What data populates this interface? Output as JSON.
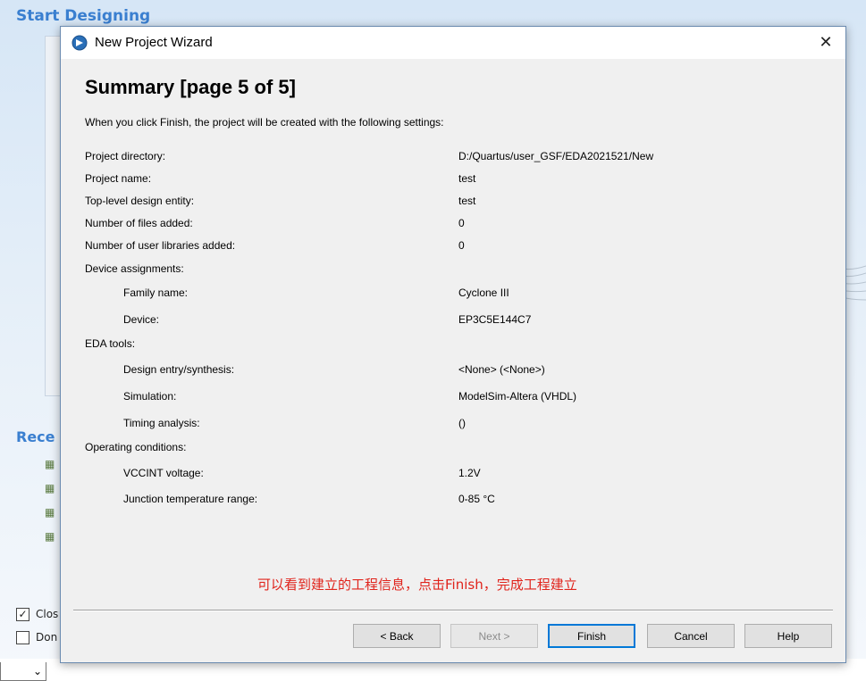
{
  "background": {
    "section_title": "Start Designing",
    "recent_title": "Rece",
    "checkbox1_label": "Clos",
    "checkbox2_label": "Don",
    "checkbox1_checked": true
  },
  "dialog": {
    "title": "New Project Wizard",
    "heading": "Summary [page 5 of 5]",
    "intro": "When you click Finish, the project will be created with the following settings:",
    "rows": [
      {
        "label": "Project directory:",
        "value": "D:/Quartus/user_GSF/EDA2021521/New"
      },
      {
        "label": "Project name:",
        "value": "test"
      },
      {
        "label": "Top-level design entity:",
        "value": "test"
      },
      {
        "label": "Number of files added:",
        "value": "0"
      },
      {
        "label": "Number of user libraries added:",
        "value": "0"
      },
      {
        "label": "Device assignments:",
        "value": ""
      },
      {
        "label": "Family name:",
        "value": "Cyclone III"
      },
      {
        "label": "Device:",
        "value": "EP3C5E144C7"
      },
      {
        "label": "EDA tools:",
        "value": ""
      },
      {
        "label": "Design entry/synthesis:",
        "value": "<None> (<None>)"
      },
      {
        "label": "Simulation:",
        "value": "ModelSim-Altera (VHDL)"
      },
      {
        "label": "Timing analysis:",
        "value": " ()"
      },
      {
        "label": "Operating conditions:",
        "value": ""
      },
      {
        "label": "VCCINT voltage:",
        "value": "1.2V"
      },
      {
        "label": "Junction temperature range:",
        "value": "0-85 °C"
      }
    ],
    "annotation": "可以看到建立的工程信息，点击Finish，完成工程建立",
    "buttons": {
      "back": "< Back",
      "next": "Next >",
      "finish": "Finish",
      "cancel": "Cancel",
      "help": "Help"
    },
    "close_glyph": "✕"
  },
  "colors": {
    "accent_blue": "#3a7fd0",
    "annotation_red": "#e0241c",
    "default_button_border": "#0078d7"
  }
}
